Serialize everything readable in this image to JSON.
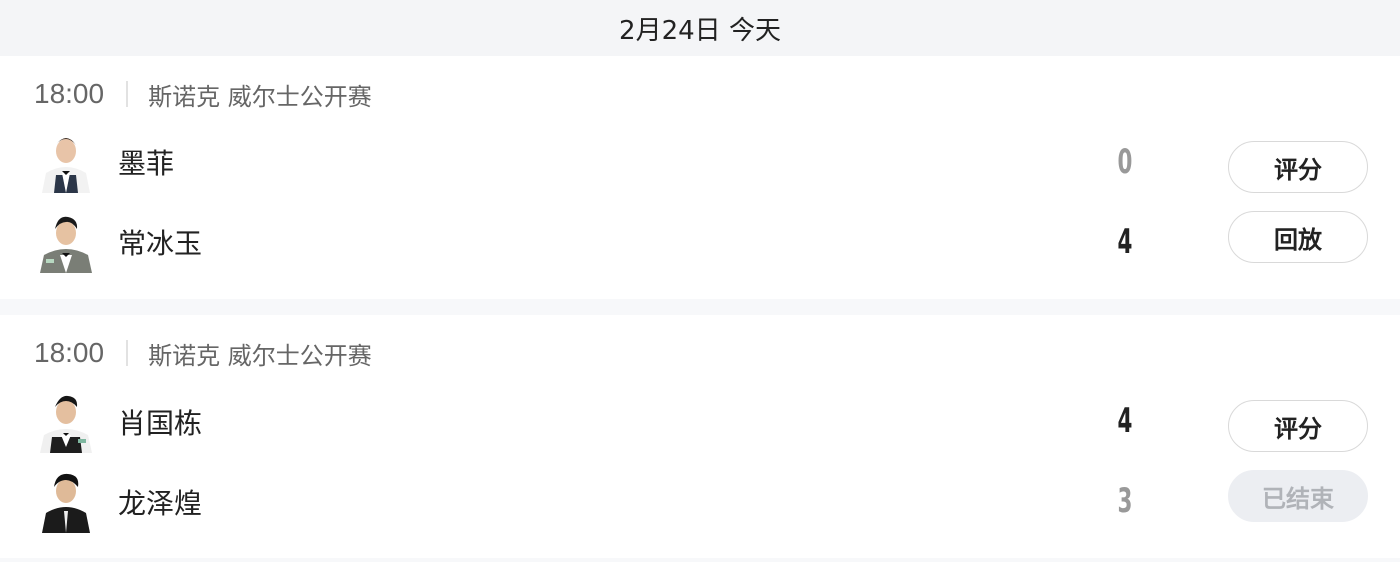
{
  "date_header": "2月24日 今天",
  "matches": [
    {
      "time": "18:00",
      "league": "斯诺克 威尔士公开赛",
      "players": [
        {
          "name": "墨菲",
          "score": "0",
          "score_style": "light",
          "avatar_icon": "player-avatar-icon"
        },
        {
          "name": "常冰玉",
          "score": "4",
          "score_style": "dark",
          "avatar_icon": "player-avatar-icon"
        }
      ],
      "buttons": [
        {
          "label": "评分",
          "enabled": true
        },
        {
          "label": "回放",
          "enabled": true
        }
      ]
    },
    {
      "time": "18:00",
      "league": "斯诺克 威尔士公开赛",
      "players": [
        {
          "name": "肖国栋",
          "score": "4",
          "score_style": "dark",
          "avatar_icon": "player-avatar-icon"
        },
        {
          "name": "龙泽煌",
          "score": "3",
          "score_style": "light",
          "avatar_icon": "player-avatar-icon"
        }
      ],
      "buttons": [
        {
          "label": "评分",
          "enabled": true
        },
        {
          "label": "已结束",
          "enabled": false
        }
      ]
    }
  ],
  "colors": {
    "header_bg": "#f4f5f7",
    "text_primary": "#222222",
    "text_secondary": "#666666",
    "score_light": "#999999",
    "button_disabled_bg": "#eceef2"
  }
}
